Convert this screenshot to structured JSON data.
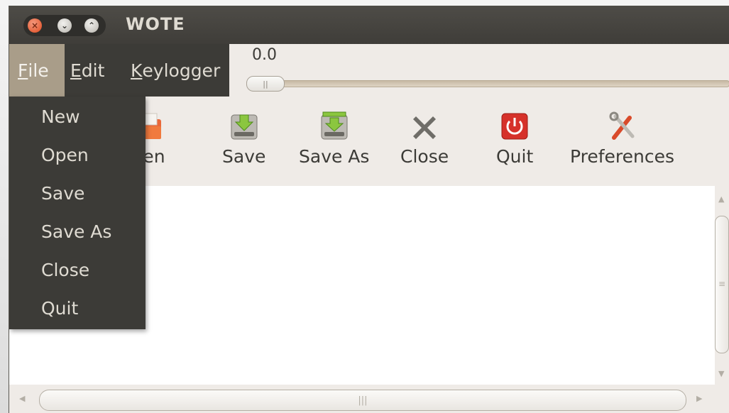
{
  "window": {
    "title": "WOTE"
  },
  "menubar": {
    "file": "File",
    "file_mnemonic": "F",
    "file_rest": "ile",
    "edit_mnemonic": "E",
    "edit_rest": "dit",
    "keylogger_mnemonic": "K",
    "keylogger_rest": "eylogger"
  },
  "slider": {
    "value": "0.0"
  },
  "toolbar": {
    "items": [
      {
        "label": "Open",
        "icon": "folder-open-icon",
        "visible_label": "pen"
      },
      {
        "label": "Save",
        "icon": "save-disk-icon"
      },
      {
        "label": "Save As",
        "icon": "save-as-disk-icon"
      },
      {
        "label": "Close",
        "icon": "close-x-icon"
      },
      {
        "label": "Quit",
        "icon": "power-icon"
      },
      {
        "label": "Preferences",
        "icon": "tools-icon"
      }
    ]
  },
  "file_menu": {
    "items": [
      "New",
      "Open",
      "Save",
      "Save As",
      "Close",
      "Quit"
    ]
  },
  "colors": {
    "titlebar": "#3c3b37",
    "menu_active": "#a99d89",
    "window_bg": "#efebe7",
    "close_button": "#df4a1e",
    "quit_icon": "#d6312a"
  }
}
